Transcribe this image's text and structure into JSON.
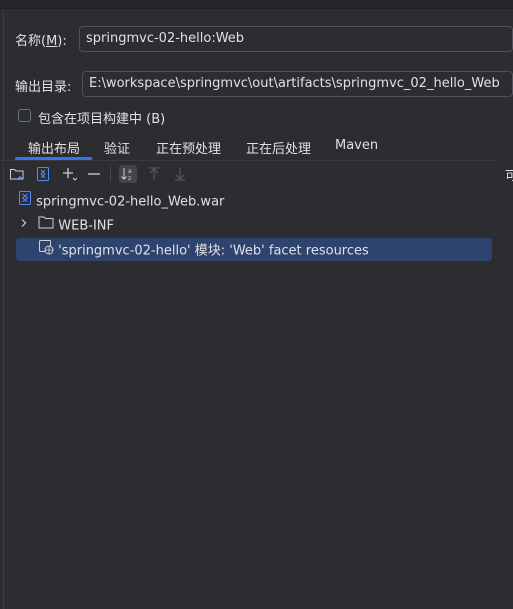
{
  "form": {
    "name_label": "名称(",
    "name_mnemonic": "M",
    "name_label_end": "):",
    "name_value": "springmvc-02-hello:Web",
    "output_dir_label": "输出目录:",
    "output_dir_value": "E:\\workspace\\springmvc\\out\\artifacts\\springmvc_02_hello_Web",
    "include_in_build_label": "包含在项目构建中 (B)",
    "include_in_build_checked": false
  },
  "tabs": [
    {
      "label": "输出布局",
      "selected": true
    },
    {
      "label": "验证",
      "selected": false
    },
    {
      "label": "正在预处理",
      "selected": false
    },
    {
      "label": "正在后处理",
      "selected": false
    },
    {
      "label": "Maven",
      "selected": false
    }
  ],
  "toolbar": {
    "icons": [
      "new-folder-icon",
      "archive-icon",
      "add-icon",
      "remove-icon",
      "sort-icon",
      "move-up-icon",
      "move-down-icon"
    ],
    "sort_active": true
  },
  "corner_text": "可",
  "tree": {
    "items": [
      {
        "label": "springmvc-02-hello_Web.war",
        "icon": "war-archive-icon",
        "level": 0
      },
      {
        "label": "WEB-INF",
        "icon": "folder-icon",
        "level": 1,
        "expandable": true
      },
      {
        "label": "'springmvc-02-hello' 模块: 'Web' facet resources",
        "icon": "web-facet-icon",
        "level": 1,
        "selected": true
      }
    ]
  },
  "colors": {
    "background": "#2b2d30",
    "accent": "#3574f0",
    "selection": "#2e436e",
    "text": "#dfe1e5"
  }
}
